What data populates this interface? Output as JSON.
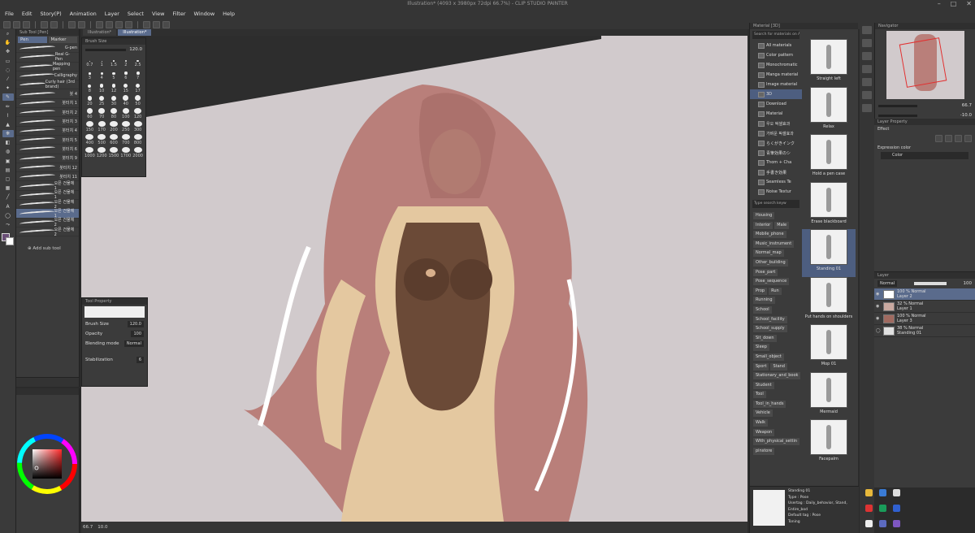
{
  "app": {
    "title": "Illustration* (4093 x 3980px 72dpi 66.7%)  - CLIP STUDIO PAINTER"
  },
  "menu": [
    "File",
    "Edit",
    "Story(P)",
    "Animation",
    "Layer",
    "Select",
    "View",
    "Filter",
    "Window",
    "Help"
  ],
  "subtool": {
    "header": "Sub Tool [Pen]",
    "tabs": [
      "Pen",
      "Marker"
    ],
    "brushes": [
      {
        "name": "G-pen"
      },
      {
        "name": "Real G-Pen"
      },
      {
        "name": "Mapping pen"
      },
      {
        "name": "Calligraphy"
      },
      {
        "name": "Curly hair (3rd brand)"
      },
      {
        "name": "붓 4"
      },
      {
        "name": "붓터치 1"
      },
      {
        "name": "붓터치 2"
      },
      {
        "name": "붓터치 3"
      },
      {
        "name": "붓터치 4"
      },
      {
        "name": "붓터치 5"
      },
      {
        "name": "붓터치 6"
      },
      {
        "name": "붓터치 9"
      },
      {
        "name": "붓터치 12"
      },
      {
        "name": "붓터치 11"
      },
      {
        "name": "오픈 건물체 1"
      },
      {
        "name": "오픈 건물체 1"
      },
      {
        "name": "오픈 건물체 2"
      },
      {
        "name": "오픈 건물체 1"
      },
      {
        "name": "오픈 건물체 2"
      },
      {
        "name": "오픈 건물체 2"
      }
    ],
    "add_label": "Add sub tool"
  },
  "brushsize": {
    "header": "Brush Size",
    "value": "120.0",
    "sizes": [
      "0.7",
      "1",
      "1.5",
      "2",
      "2.5",
      "3",
      "4",
      "5",
      "6",
      "7",
      "8",
      "10",
      "12",
      "15",
      "17",
      "20",
      "25",
      "30",
      "40",
      "50",
      "60",
      "70",
      "80",
      "100",
      "120",
      "150",
      "170",
      "200",
      "250",
      "300",
      "400",
      "500",
      "600",
      "700",
      "800",
      "1000",
      "1200",
      "1500",
      "1700",
      "2000"
    ]
  },
  "toolprop": {
    "header": "Tool Property",
    "brush_size_label": "Brush Size",
    "brush_size_value": "120.0",
    "opacity_label": "Opacity",
    "opacity_value": "100",
    "blend_label": "Blending mode",
    "blend_value": "Normal",
    "stab_label": "Stabilization",
    "stab_value": "6"
  },
  "canvas": {
    "tabs": [
      "Illustration*",
      "Illustration*"
    ],
    "zoom": "66.7",
    "angle": "10.0"
  },
  "material": {
    "header": "Material [3D]",
    "search_placeholder": "Search for materials on ASSETS",
    "tree": [
      "All materials",
      "Color pattern",
      "Monochromatic",
      "Manga material",
      "Image material",
      "3D",
      "Download",
      "Material",
      "우오 픽셀효과",
      "가벼운 픽셀효과",
      "らくがきインク",
      "青筆効果のシ",
      "Thom + Cha",
      "手書き効果",
      "Seamless Te",
      "Noise Textur"
    ],
    "tag_search_placeholder": "Type search keyw",
    "tags": [
      [
        "Housing"
      ],
      [
        "Interior",
        "Male"
      ],
      [
        "Mobile_phone"
      ],
      [
        "Music_instrument"
      ],
      [
        "Normal_map"
      ],
      [
        "Other_building"
      ],
      [
        "Pose_part"
      ],
      [
        "Pose_sequence"
      ],
      [
        "Prop",
        "Run"
      ],
      [
        "Running"
      ],
      [
        "School"
      ],
      [
        "School_facility"
      ],
      [
        "School_supply"
      ],
      [
        "Sit_down"
      ],
      [
        "Sleep"
      ],
      [
        "Small_object"
      ],
      [
        "Sport",
        "Stand"
      ],
      [
        "Stationary_and_book"
      ],
      [
        "Student"
      ],
      [
        "Tool"
      ],
      [
        "Tool_in_hands"
      ],
      [
        "Vehicle"
      ],
      [
        "Walk"
      ],
      [
        "Weapon"
      ],
      [
        "With_physical_settin"
      ],
      [
        "pinstore"
      ]
    ],
    "thumbs": [
      "Straight left",
      "Relax",
      "Hold a pen case",
      "Erase blackboard",
      "Standing 01",
      "Put hands on shoulders",
      "Mop 01",
      "Mermaid",
      "Facepalm"
    ],
    "detail": {
      "title": "Standing 01",
      "type": "Type : Pose",
      "usertag": "Usertag : Daily_behavior, Stand, Entire_bod",
      "default_tag": "Default tag : Pose",
      "tone": "Toning"
    }
  },
  "navigator": {
    "header": "Navigator",
    "zoom": "66.7",
    "angle": "-10.0"
  },
  "layerprop": {
    "header": "Layer Property",
    "effect_label": "Effect",
    "expression_label": "Expression color",
    "expression_value": "Color"
  },
  "layers": {
    "header": "Layer",
    "blend": "Normal",
    "opacity": "100",
    "items": [
      {
        "pct": "100 % Normal",
        "name": "Layer 2"
      },
      {
        "pct": "32 % Normal",
        "name": "Layer 1"
      },
      {
        "pct": "100 % Normal",
        "name": "Layer 3"
      },
      {
        "pct": "38 % Normal",
        "name": "Standing 01"
      }
    ]
  },
  "colors": {
    "canvas_bg": "#d1cacc",
    "canvas_dark": "#2d2d2d",
    "hair": "#b97f7a",
    "skin": "#e4c8a0",
    "suit": "#6b4a37",
    "accent": "#5a6b8c"
  }
}
